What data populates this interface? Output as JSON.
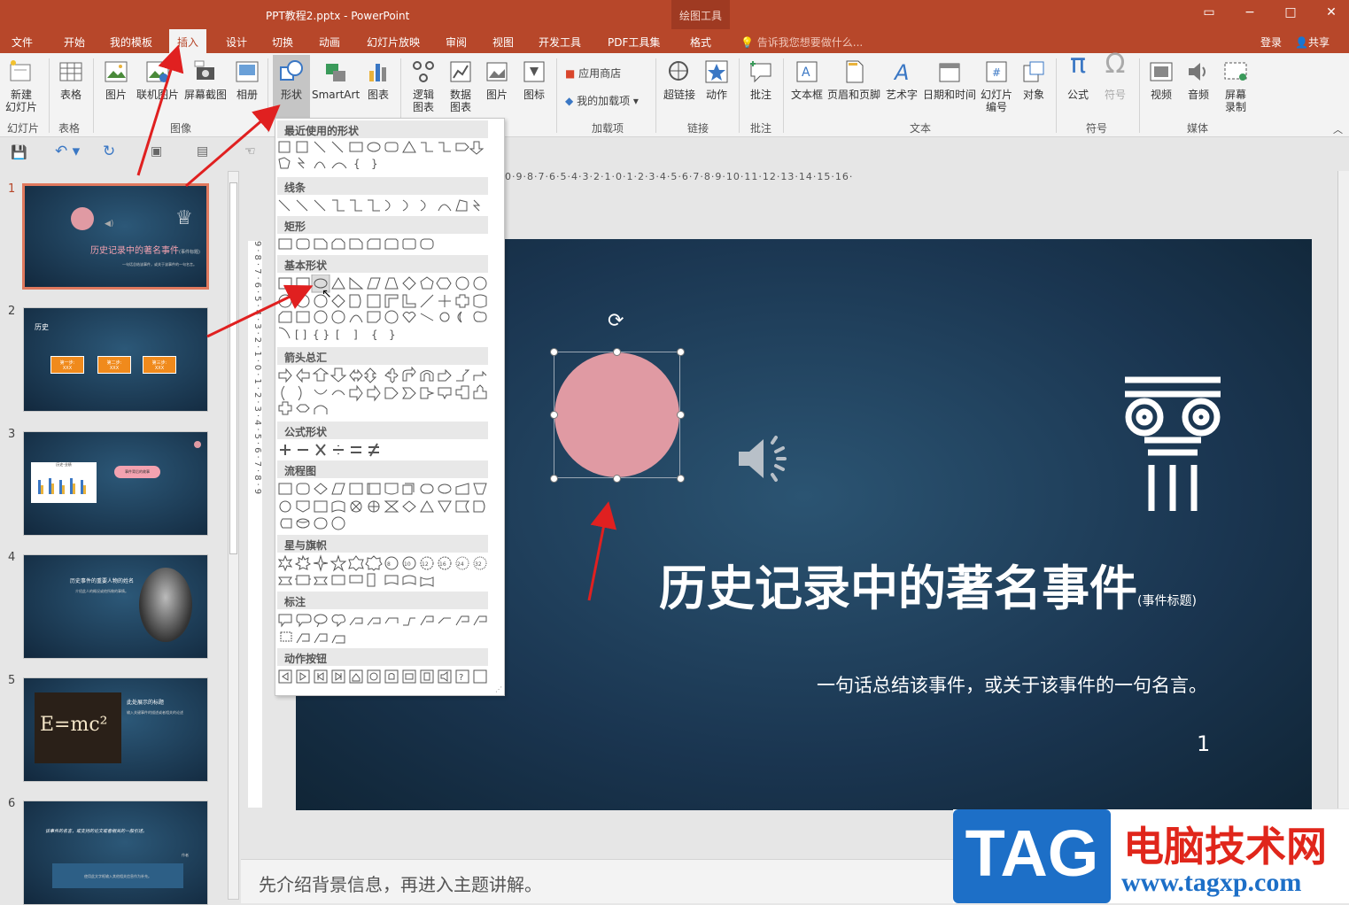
{
  "window": {
    "title": "PPT教程2.pptx - PowerPoint",
    "context_tab_title": "绘图工具",
    "controls": [
      "▭",
      "−",
      "□",
      "✕"
    ]
  },
  "menu": {
    "tabs": [
      "文件",
      "开始",
      "我的模板",
      "插入",
      "设计",
      "切换",
      "动画",
      "幻灯片放映",
      "审阅",
      "视图",
      "开发工具",
      "PDF工具集",
      "格式"
    ],
    "active": "插入",
    "tell_me": "告诉我您想要做什么...",
    "login": "登录",
    "share": "共享"
  },
  "ribbon": {
    "buttons": [
      {
        "id": "new-slide",
        "label": "新建\n幻灯片"
      },
      {
        "id": "table",
        "label": "表格"
      },
      {
        "id": "picture",
        "label": "图片"
      },
      {
        "id": "online-picture",
        "label": "联机图片"
      },
      {
        "id": "screenshot",
        "label": "屏幕截图"
      },
      {
        "id": "album",
        "label": "相册"
      },
      {
        "id": "shapes",
        "label": "形状"
      },
      {
        "id": "smartart",
        "label": "SmartArt"
      },
      {
        "id": "chart",
        "label": "图表"
      },
      {
        "id": "logic-chart",
        "label": "逻辑\n图表"
      },
      {
        "id": "data-chart",
        "label": "数据\n图表"
      },
      {
        "id": "picture2",
        "label": "图片"
      },
      {
        "id": "icon",
        "label": "图标"
      },
      {
        "id": "store",
        "label": "应用商店"
      },
      {
        "id": "my-addins",
        "label": "我的加载项"
      },
      {
        "id": "hyperlink",
        "label": "超链接"
      },
      {
        "id": "action",
        "label": "动作"
      },
      {
        "id": "comment",
        "label": "批注"
      },
      {
        "id": "textbox",
        "label": "文本框"
      },
      {
        "id": "header-footer",
        "label": "页眉和页脚"
      },
      {
        "id": "wordart",
        "label": "艺术字"
      },
      {
        "id": "datetime",
        "label": "日期和时间"
      },
      {
        "id": "slide-number",
        "label": "幻灯片\n编号"
      },
      {
        "id": "object",
        "label": "对象"
      },
      {
        "id": "equation",
        "label": "公式"
      },
      {
        "id": "symbol",
        "label": "符号"
      },
      {
        "id": "video",
        "label": "视频"
      },
      {
        "id": "audio",
        "label": "音频"
      },
      {
        "id": "screen-record",
        "label": "屏幕\n录制"
      }
    ],
    "groups": [
      "幻灯片",
      "表格",
      "图像",
      "加载项",
      "链接",
      "批注",
      "文本",
      "符号",
      "媒体"
    ]
  },
  "shapes_menu": {
    "sections": [
      "最近使用的形状",
      "线条",
      "矩形",
      "基本形状",
      "箭头总汇",
      "公式形状",
      "流程图",
      "星与旗帜",
      "标注",
      "动作按钮"
    ]
  },
  "ruler": {
    "horizontal": "0·9·8·7·6·5·4·3·2·1·0·1·2·3·4·5·6·7·8·9·10·11·12·13·14·15·16·",
    "vertical": "9·8·7·6·5·4·3·2·1·0·1·2·3·4·5·6·7·8·9"
  },
  "thumbnails": {
    "numbers": [
      "1",
      "2",
      "3",
      "4",
      "5",
      "6"
    ],
    "t1_title": "历史记录中的著名事件",
    "t1_sub": "(事件标题)",
    "t1_desc": "一句话总结该事件，或关于该事件的一句名言。",
    "t2_title": "历史",
    "t2_steps": [
      "第一步:",
      "第二步:",
      "第三步:"
    ],
    "t2_step_sub": "XXX",
    "t3_chart_title": "历史-业绩",
    "t3_bubble": "事件背后的故事",
    "t4_title": "历史事件的重要人物的姓名",
    "t4_sub": "介绍此人的概况或他所做的事情。",
    "t5_formula": "E=mc²",
    "t5_title": "此处展示的标题",
    "t5_body": "输入关键事件的描述或者相关的论述",
    "t6_quote": "该事件的名言，或支持的论文或者相关的一般引述。",
    "t6_author": "作者",
    "t6_body": "使用此文字框输入其他相关信息作为补充。"
  },
  "slide": {
    "title": "历史记录中的著名事件",
    "title_note": "(事件标题)",
    "subtitle": "一句话总结该事件，或关于该事件的一句名言。",
    "number": "1",
    "circle_color": "#e09aa3"
  },
  "notes": {
    "text": "先介绍背景信息，再进入主题讲解。"
  },
  "watermark": {
    "tag": "TAG",
    "site_name": "电脑技术网",
    "url": "www.tagxp.com"
  },
  "colors": {
    "accent": "#b7472a",
    "selection": "#e0795e",
    "annotation_arrow": "#e02020"
  }
}
